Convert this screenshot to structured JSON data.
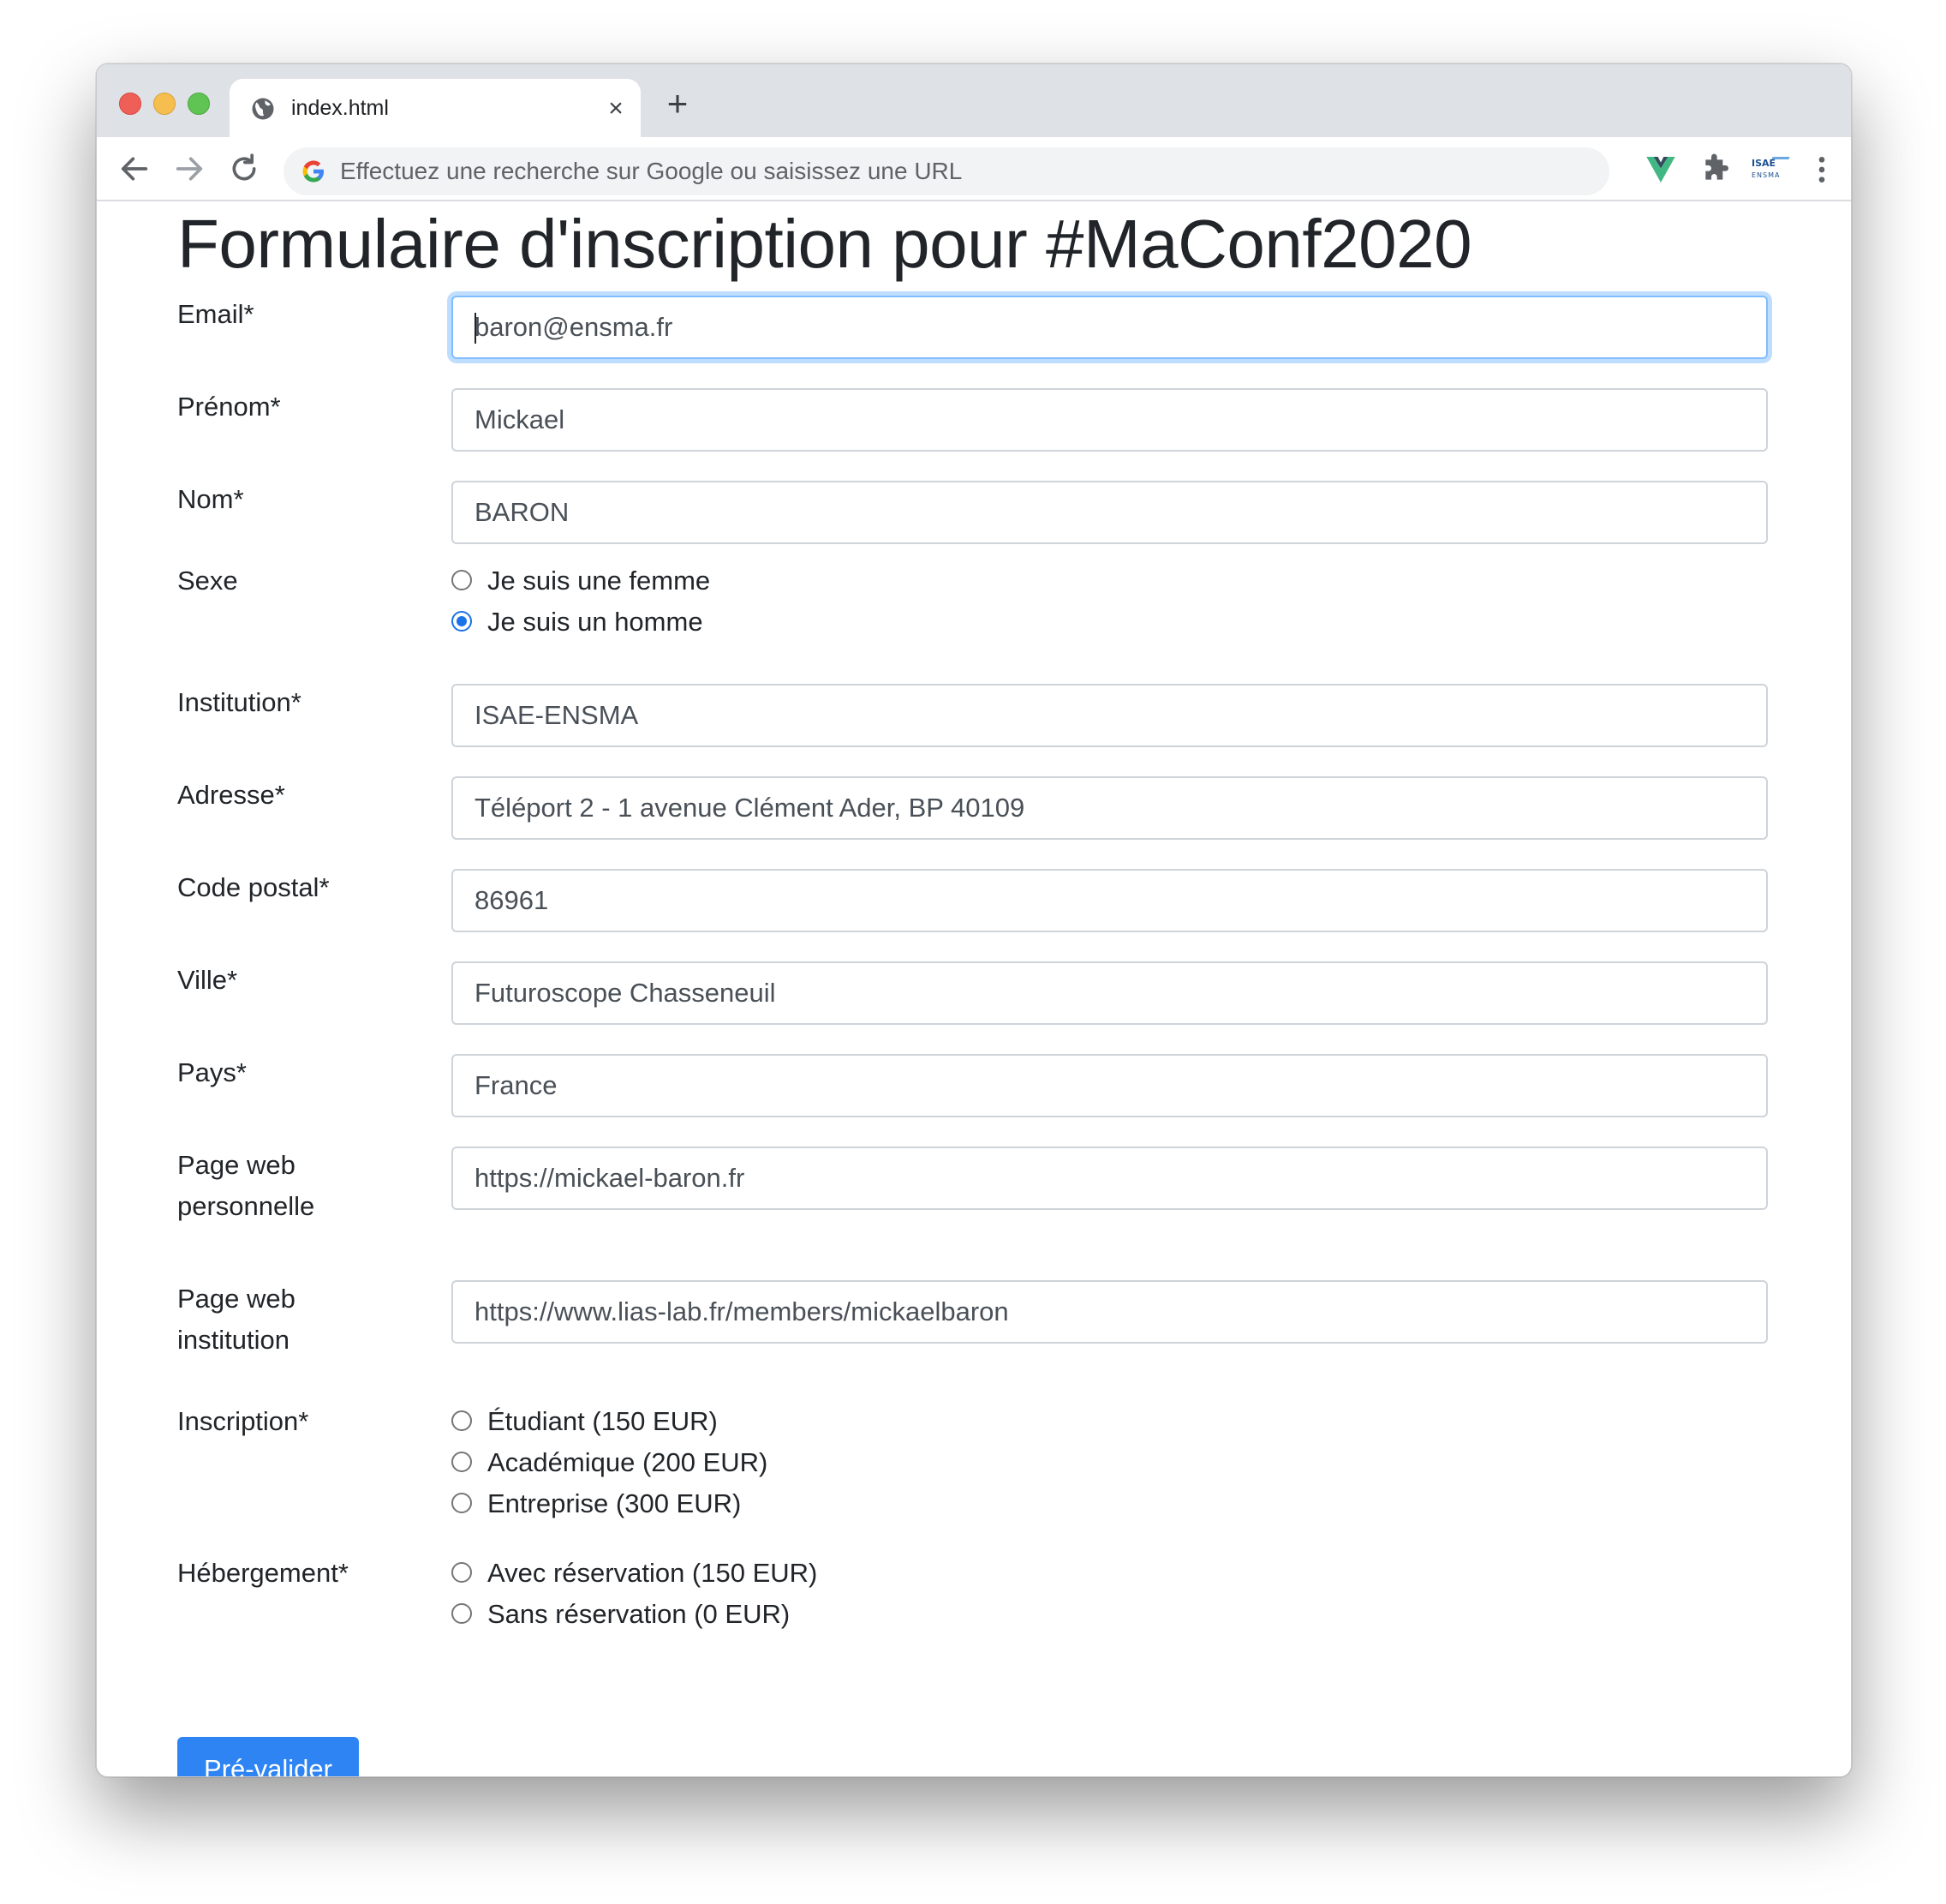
{
  "browser": {
    "tab_title": "index.html",
    "new_tab_symbol": "+",
    "close_symbol": "×",
    "omnibox_placeholder": "Effectuez une recherche sur Google ou saisissez une URL",
    "ext_logo_text_top": "ISAE",
    "ext_logo_text_bottom": "ENSMA"
  },
  "page": {
    "title": "Formulaire d'inscription pour #MaConf2020",
    "fields": {
      "email": {
        "label": "Email*",
        "value": "baron@ensma.fr"
      },
      "prenom": {
        "label": "Prénom*",
        "value": "Mickael"
      },
      "nom": {
        "label": "Nom*",
        "value": "BARON"
      },
      "institution": {
        "label": "Institution*",
        "value": "ISAE-ENSMA"
      },
      "adresse": {
        "label": "Adresse*",
        "value": "Téléport 2 - 1 avenue Clément Ader, BP 40109"
      },
      "code_postal": {
        "label": "Code postal*",
        "value": "86961"
      },
      "ville": {
        "label": "Ville*",
        "value": "Futuroscope Chasseneuil"
      },
      "pays": {
        "label": "Pays*",
        "value": "France"
      },
      "page_perso": {
        "label_line1": "Page web",
        "label_line2": "personnelle",
        "value": "https://mickael-baron.fr"
      },
      "page_institution": {
        "label_line1": "Page web",
        "label_line2": "institution",
        "value": "https://www.lias-lab.fr/members/mickaelbaron"
      }
    },
    "sexe": {
      "label": "Sexe",
      "options": [
        "Je suis une femme",
        "Je suis un homme"
      ],
      "selected": "Je suis un homme"
    },
    "inscription": {
      "label": "Inscription*",
      "options": [
        "Étudiant (150 EUR)",
        "Académique (200 EUR)",
        "Entreprise (300 EUR)"
      ]
    },
    "hebergement": {
      "label": "Hébergement*",
      "options": [
        "Avec réservation (150 EUR)",
        "Sans réservation (0 EUR)"
      ]
    },
    "submit_label": "Pré-valider"
  },
  "colors": {
    "primary": "#2f84f4",
    "radio_checked": "#1a73e8",
    "focus_border": "#80bdff"
  }
}
